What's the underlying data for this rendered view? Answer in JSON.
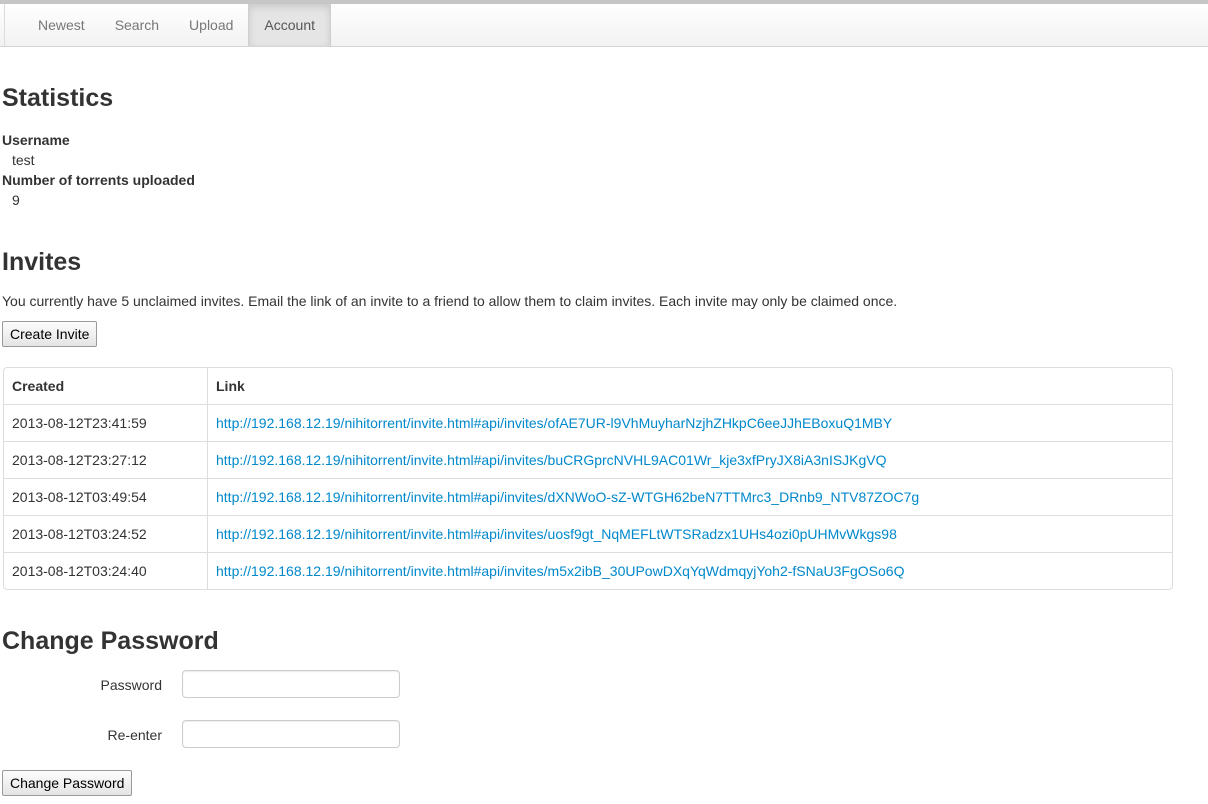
{
  "nav": {
    "items": [
      {
        "label": "Newest",
        "active": false
      },
      {
        "label": "Search",
        "active": false
      },
      {
        "label": "Upload",
        "active": false
      },
      {
        "label": "Account",
        "active": true
      }
    ]
  },
  "statistics": {
    "title": "Statistics",
    "username_label": "Username",
    "username_value": "test",
    "torrents_label": "Number of torrents uploaded",
    "torrents_value": "9"
  },
  "invites": {
    "title": "Invites",
    "description": "You currently have 5 unclaimed invites. Email the link of an invite to a friend to allow them to claim invites. Each invite may only be claimed once.",
    "create_button": "Create Invite",
    "columns": [
      "Created",
      "Link"
    ],
    "rows": [
      {
        "created": "2013-08-12T23:41:59",
        "link": "http://192.168.12.19/nihitorrent/invite.html#api/invites/ofAE7UR-l9VhMuyharNzjhZHkpC6eeJJhEBoxuQ1MBY"
      },
      {
        "created": "2013-08-12T23:27:12",
        "link": "http://192.168.12.19/nihitorrent/invite.html#api/invites/buCRGprcNVHL9AC01Wr_kje3xfPryJX8iA3nISJKgVQ"
      },
      {
        "created": "2013-08-12T03:49:54",
        "link": "http://192.168.12.19/nihitorrent/invite.html#api/invites/dXNWoO-sZ-WTGH62beN7TTMrc3_DRnb9_NTV87ZOC7g"
      },
      {
        "created": "2013-08-12T03:24:52",
        "link": "http://192.168.12.19/nihitorrent/invite.html#api/invites/uosf9gt_NqMEFLtWTSRadzx1UHs4ozi0pUHMvWkgs98"
      },
      {
        "created": "2013-08-12T03:24:40",
        "link": "http://192.168.12.19/nihitorrent/invite.html#api/invites/m5x2ibB_30UPowDXqYqWdmqyjYoh2-fSNaU3FgOSo6Q"
      }
    ]
  },
  "change_password": {
    "title": "Change Password",
    "password_label": "Password",
    "password_value": "",
    "reenter_label": "Re-enter",
    "reenter_value": "",
    "submit_button": "Change Password"
  },
  "colors": {
    "link": "#0088cc",
    "active_tab_bg": "#e5e5e5"
  }
}
